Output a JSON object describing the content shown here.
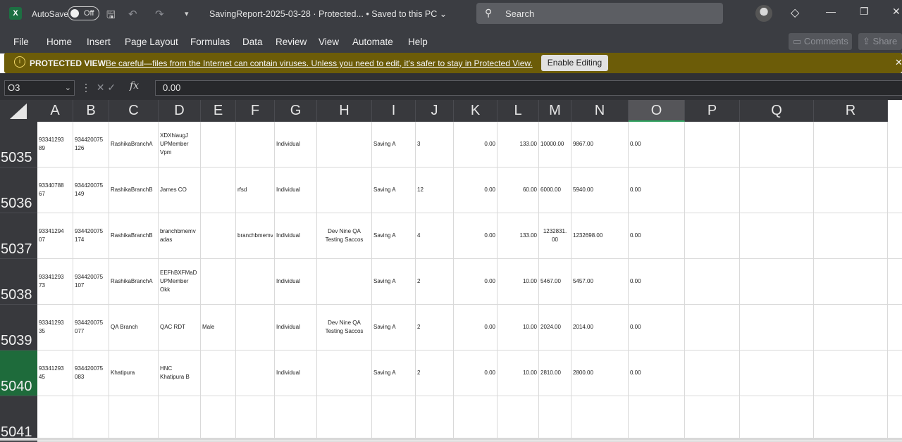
{
  "titlebar": {
    "app_logo": "X",
    "autosave_label": "AutoSave",
    "autosave_state": "Off",
    "doc_title": "SavingReport-2025-03-28  ·  Protected...  •  Saved to this PC ⌄",
    "search_placeholder": "Search",
    "icons": [
      "save-icon",
      "undo-icon",
      "redo-icon",
      "customize-icon",
      "search-icon",
      "diamond-icon",
      "minimize-icon",
      "restore-icon",
      "close-icon"
    ]
  },
  "menu": {
    "items": [
      "File",
      "Home",
      "Insert",
      "Page Layout",
      "Formulas",
      "Data",
      "Review",
      "View",
      "Automate",
      "Help"
    ],
    "comments_label": "Comments",
    "share_label": "Share"
  },
  "protected_view": {
    "title": "PROTECTED VIEW",
    "message": "Be careful—files from the Internet can contain viruses. Unless you need to edit, it's safer to stay in Protected View.",
    "button": "Enable Editing",
    "bg_color": "#6c5c08"
  },
  "formula_bar": {
    "name_box": "O3",
    "value": "0.00"
  },
  "columns": [
    "A",
    "B",
    "C",
    "D",
    "E",
    "F",
    "G",
    "H",
    "I",
    "J",
    "K",
    "L",
    "M",
    "N",
    "O",
    "P",
    "Q",
    "R"
  ],
  "selected_column": "O",
  "rows": [
    {
      "num": "5035",
      "A": "93341293\n89",
      "B": "934420075\n126",
      "C": "RashikaBranchA",
      "D": "XDXhiaugJ\nUPMember\nVpm",
      "E": "",
      "F": "",
      "G": "Individual",
      "H": "",
      "I": "Saving A",
      "J": "3",
      "K": "0.00",
      "L": "133.00",
      "M": "10000.00",
      "N": "9867.00",
      "O": "0.00"
    },
    {
      "num": "5036",
      "A": "93340788\n67",
      "B": "934420075\n149",
      "C": "RashikaBranchB",
      "D": "James  CO",
      "E": "",
      "F": "rfsd",
      "G": "Individual",
      "H": "",
      "I": "Saving A",
      "J": "12",
      "K": "0.00",
      "L": "60.00",
      "M": "6000.00",
      "N": "5940.00",
      "O": "0.00"
    },
    {
      "num": "5037",
      "A": "93341294\n07",
      "B": "934420075\n174",
      "C": "RashikaBranchB",
      "D": "branchbmemv\nadas",
      "E": "",
      "F": "branchbmemv",
      "G": "Individual",
      "H": "Dev  Nine QA\nTesting Saccos",
      "I": "Saving A",
      "J": "4",
      "K": "0.00",
      "L": "133.00",
      "M": "1232831.\n00",
      "N": "1232698.00",
      "O": "0.00"
    },
    {
      "num": "5038",
      "A": "93341293\n73",
      "B": "934420075\n107",
      "C": "RashikaBranchA",
      "D": "EEFhBXFMaD\nUPMember\nOkk",
      "E": "",
      "F": "",
      "G": "Individual",
      "H": "",
      "I": "Saving A",
      "J": "2",
      "K": "0.00",
      "L": "10.00",
      "M": "5467.00",
      "N": "5457.00",
      "O": "0.00"
    },
    {
      "num": "5039",
      "A": "93341293\n35",
      "B": "934420075\n077",
      "C": "QA Branch",
      "D": "QAC  RDT",
      "E": "Male",
      "F": "",
      "G": "Individual",
      "H": "Dev  Nine QA\nTesting Saccos",
      "I": "Saving A",
      "J": "2",
      "K": "0.00",
      "L": "10.00",
      "M": "2024.00",
      "N": "2014.00",
      "O": "0.00"
    },
    {
      "num": "5040",
      "A": "93341293\n45",
      "B": "934420075\n083",
      "C": "Khatipura",
      "D": "HNC\nKhatipura B",
      "E": "",
      "F": "",
      "G": "Individual",
      "H": "",
      "I": "Saving A",
      "J": "2",
      "K": "0.00",
      "L": "10.00",
      "M": "2810.00",
      "N": "2800.00",
      "O": "0.00"
    },
    {
      "num": "5041",
      "A": "",
      "B": "",
      "C": "",
      "D": "",
      "E": "",
      "F": "",
      "G": "",
      "H": "",
      "I": "",
      "J": "",
      "K": "",
      "L": "",
      "M": "",
      "N": "",
      "O": ""
    }
  ],
  "selected_row": "5040"
}
